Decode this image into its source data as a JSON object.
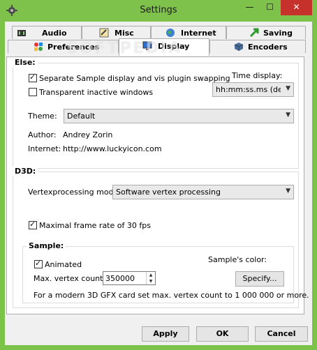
{
  "window": {
    "title": "Settings",
    "close_label": "✕",
    "minimize_label": "—",
    "maximize_label": "☐"
  },
  "watermark": "SOFTPEDIA",
  "tabs_row1": [
    {
      "label": "Audio",
      "icon": "speaker-icon"
    },
    {
      "label": "Misc",
      "icon": "tools-icon"
    },
    {
      "label": "Internet",
      "icon": "globe-icon"
    },
    {
      "label": "Saving",
      "icon": "save-arrow-icon"
    }
  ],
  "tabs_row2": [
    {
      "label": "Preferences",
      "icon": "shapes-icon"
    },
    {
      "label": "Display",
      "icon": "monitor-icon",
      "active": true
    },
    {
      "label": "Encoders",
      "icon": "cube-icon"
    }
  ],
  "else": {
    "title": "Else:",
    "separate_label": "Separate Sample display and vis plugin swapping",
    "separate_checked": true,
    "transparent_label": "Transparent inactive windows",
    "transparent_checked": false,
    "time_display_label": "Time display:",
    "time_display_value": "hh:mm:ss.ms (default)",
    "theme_label": "Theme:",
    "theme_value": "Default",
    "author_label": "Author:",
    "author_value": "Andrey Zorin",
    "internet_label": "Internet:",
    "internet_value": "http://www.luckyicon.com"
  },
  "d3d": {
    "title": "D3D:",
    "vertex_mode_label": "Vertexprocessing mode:",
    "vertex_mode_value": "Software vertex processing",
    "max_frame_label": "Maximal frame rate of 30 fps",
    "max_frame_checked": true
  },
  "sample": {
    "title": "Sample:",
    "animated_label": "Animated",
    "animated_checked": true,
    "color_label": "Sample's color:",
    "max_vertex_label": "Max. vertex count:",
    "max_vertex_value": "350000",
    "specify_label": "Specify...",
    "hint": "For a modern 3D GFX card set max. vertex count to 1 000 000 or more.",
    "color": "#1f6e1c"
  },
  "buttons": {
    "apply": "Apply",
    "ok": "OK",
    "cancel": "Cancel"
  },
  "colors": {
    "titlebar": "#7ec24c",
    "close": "#c7312b"
  }
}
